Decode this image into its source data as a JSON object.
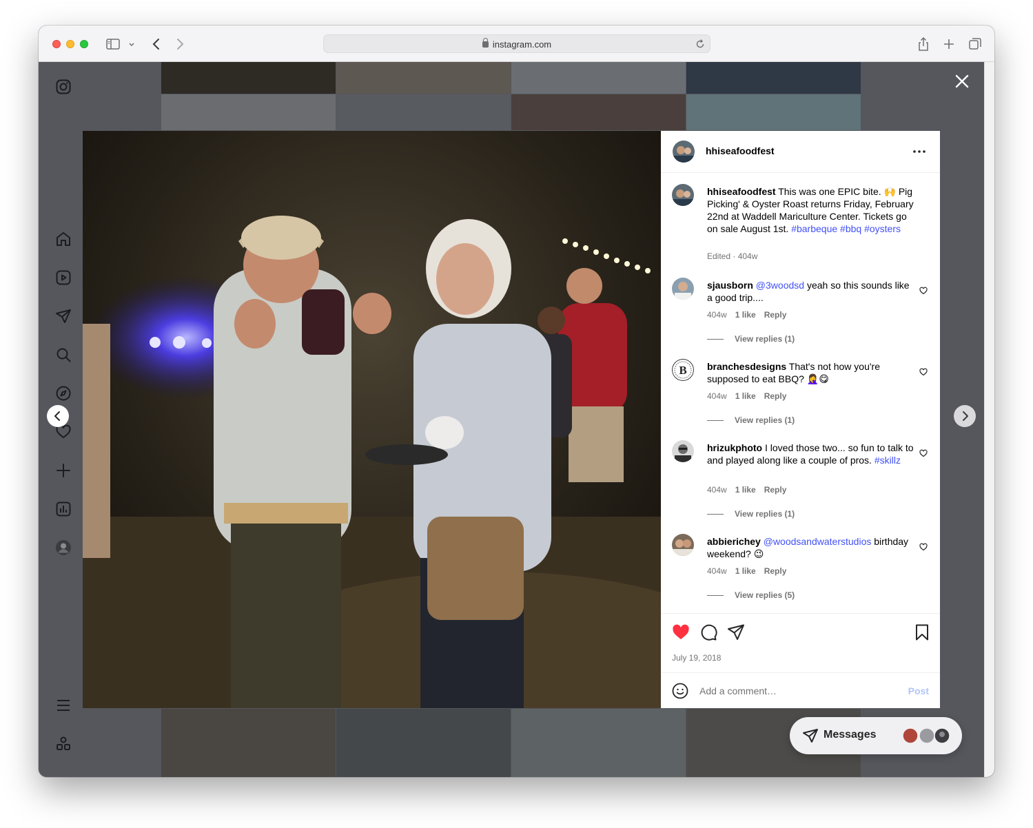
{
  "browser": {
    "url": "instagram.com"
  },
  "post": {
    "author": "hhiseafoodfest",
    "caption": {
      "username": "hhiseafoodfest",
      "text": "This was one EPIC bite. 🙌 Pig Picking' & Oyster Roast returns Friday, February 22nd at Waddell Mariculture Center. Tickets go on sale August 1st.",
      "hashtags": "#barbeque #bbq #oysters",
      "meta": "Edited · 404w"
    },
    "comments": [
      {
        "username": "sjausborn",
        "mention": "@3woodsd",
        "text": "yeah so this sounds like a good trip....",
        "age": "404w",
        "likes": "1 like",
        "reply": "Reply",
        "view_replies": "View replies (1)"
      },
      {
        "username": "branchesdesigns",
        "mention": "",
        "text": "That's not how you're supposed to eat BBQ? 🤦‍♀️😋",
        "age": "404w",
        "likes": "1 like",
        "reply": "Reply",
        "view_replies": "View replies (1)"
      },
      {
        "username": "hrizukphoto",
        "mention": "",
        "text": "I loved those two... so fun to talk to and played along like a couple of pros.",
        "hashtag": "#skillz",
        "age": "404w",
        "likes": "1 like",
        "reply": "Reply",
        "view_replies": "View replies (1)"
      },
      {
        "username": "abbierichey",
        "mention": "@woodsandwaterstudios",
        "text": "birthday weekend? 😉",
        "age": "404w",
        "likes": "1 like",
        "reply": "Reply",
        "view_replies": "View replies (5)"
      }
    ],
    "date": "July 19, 2018",
    "comment_placeholder": "Add a comment…",
    "post_button": "Post",
    "liked": true
  },
  "messages": {
    "label": "Messages"
  },
  "colors": {
    "like_red": "#ff3040",
    "link_blue": "#4150f7",
    "post_disabled": "#b2c5f8"
  }
}
